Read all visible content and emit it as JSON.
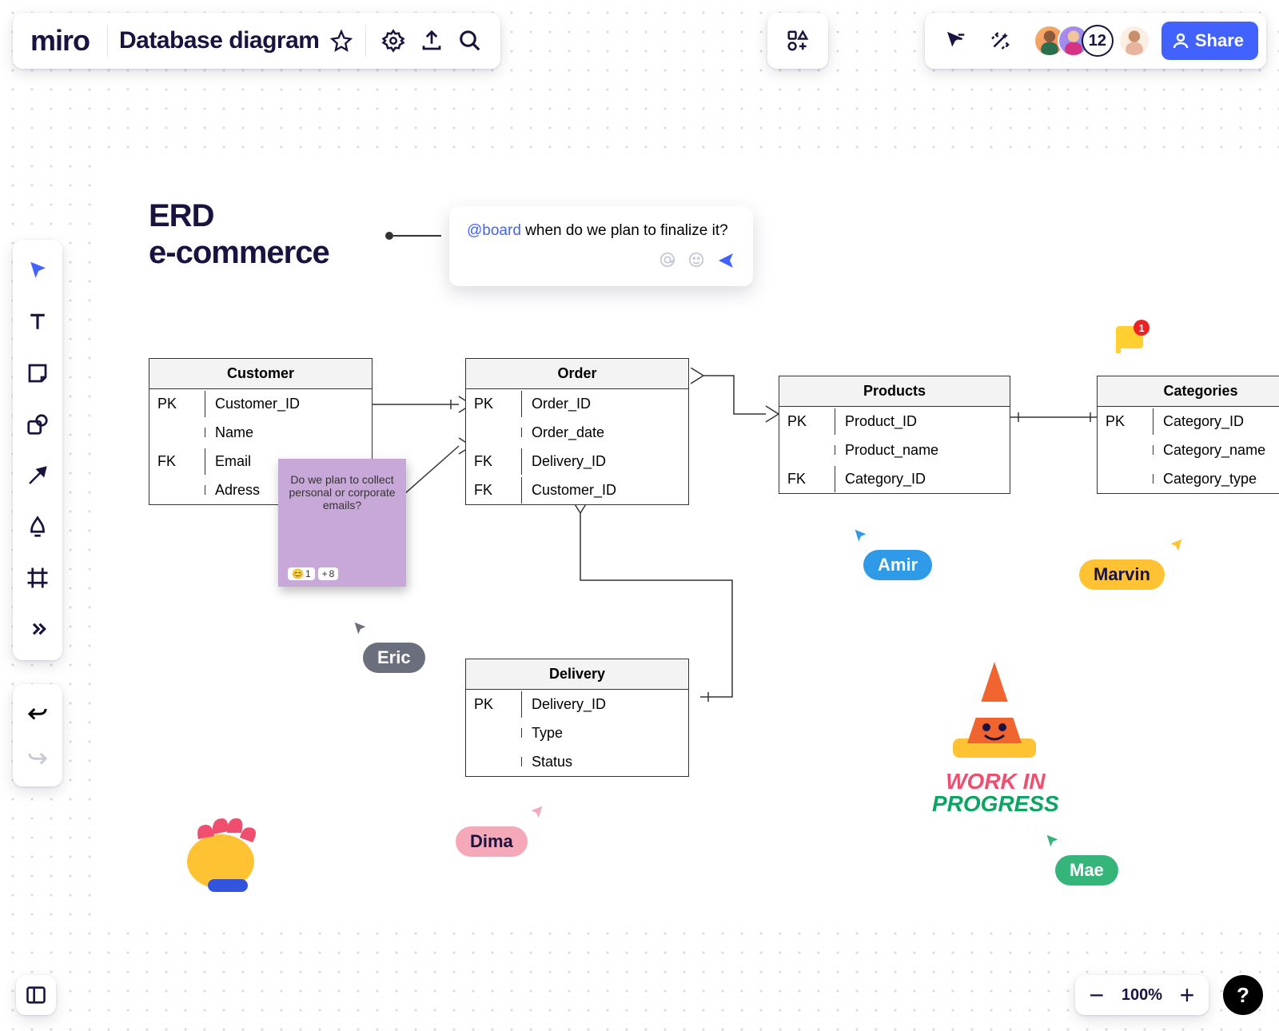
{
  "app": {
    "logo": "miro",
    "board_title": "Database diagram"
  },
  "header_right": {
    "participant_count": "12",
    "share_label": "Share"
  },
  "diagram": {
    "title_line1": "ERD",
    "title_line2": "e-commerce"
  },
  "entities": {
    "customer": {
      "name": "Customer",
      "rows": [
        {
          "k": "PK",
          "v": "Customer_ID"
        },
        {
          "k": "",
          "v": "Name"
        },
        {
          "k": "FK",
          "v": "Email"
        },
        {
          "k": "",
          "v": "Adress"
        }
      ]
    },
    "order": {
      "name": "Order",
      "rows": [
        {
          "k": "PK",
          "v": "Order_ID"
        },
        {
          "k": "",
          "v": "Order_date"
        },
        {
          "k": "FK",
          "v": "Delivery_ID"
        },
        {
          "k": "FK",
          "v": "Customer_ID"
        }
      ]
    },
    "products": {
      "name": "Products",
      "rows": [
        {
          "k": "PK",
          "v": "Product_ID"
        },
        {
          "k": "",
          "v": "Product_name"
        },
        {
          "k": "FK",
          "v": "Category_ID"
        }
      ]
    },
    "categories": {
      "name": "Categories",
      "rows": [
        {
          "k": "PK",
          "v": "Category_ID"
        },
        {
          "k": "",
          "v": "Category_name"
        },
        {
          "k": "",
          "v": "Category_type"
        }
      ]
    },
    "delivery": {
      "name": "Delivery",
      "rows": [
        {
          "k": "PK",
          "v": "Delivery_ID"
        },
        {
          "k": "",
          "v": "Type"
        },
        {
          "k": "",
          "v": "Status"
        }
      ]
    }
  },
  "sticky": {
    "text": "Do we plan to collect personal or corporate emails?",
    "react1": "1",
    "react2_prefix": "+",
    "react2": "8"
  },
  "comment": {
    "mention": "@board",
    "text": " when do we plan to finalize it?"
  },
  "cursors": {
    "eric": "Eric",
    "dima": "Dima",
    "amir": "Amir",
    "marvin": "Marvin",
    "mae": "Mae"
  },
  "wip": {
    "l1a": "WORK ",
    "l1b": "IN",
    "l2": "PROGRESS"
  },
  "badge": {
    "count": "1"
  },
  "zoom": {
    "value": "100%"
  },
  "help": {
    "label": "?"
  }
}
